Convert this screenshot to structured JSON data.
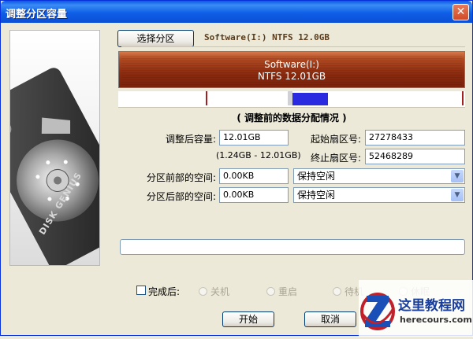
{
  "window": {
    "title": "调整分区容量",
    "close_label": "✕"
  },
  "toolbar": {
    "select_partition_label": "选择分区"
  },
  "partition": {
    "header": "Software(I:) NTFS 12.0GB",
    "bar_name": "Software(I:)",
    "bar_fs_size": "NTFS 12.01GB"
  },
  "layout_note": "( 调整前的数据分配情况 )",
  "fields": {
    "size_after_label": "调整后容量:",
    "size_after_value": "12.01GB",
    "size_range": "(1.24GB - 12.01GB)",
    "start_sector_label": "起始扇区号:",
    "start_sector_value": "27278433",
    "end_sector_label": "终止扇区号:",
    "end_sector_value": "52468289",
    "space_before_label": "分区前部的空间:",
    "space_before_value": "0.00KB",
    "space_before_option": "保持空闲",
    "space_after_label": "分区后部的空间:",
    "space_after_value": "0.00KB",
    "space_after_option": "保持空闲"
  },
  "progress": {
    "fraction": 0.0
  },
  "completion": {
    "checkbox_label": "完成后:",
    "options": [
      "关机",
      "重启",
      "待机",
      "休眠"
    ]
  },
  "buttons": {
    "start_label": "开始",
    "cancel_label": "取消"
  },
  "art": {
    "brand_text": "DISK GENIUS"
  },
  "watermark": {
    "title": "这里教程网",
    "url": "herecours.com"
  },
  "colors": {
    "titlebar": "#0a58e6",
    "partition_bar": "#8c2b0f",
    "strip_block": "#2a2ae0"
  }
}
